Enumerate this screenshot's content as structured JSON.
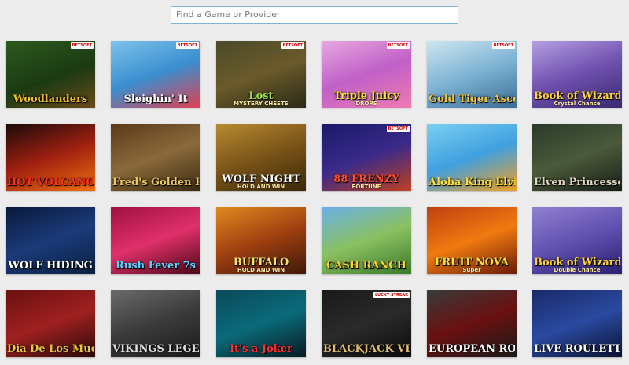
{
  "search": {
    "placeholder": "Find a Game or Provider",
    "value": ""
  },
  "games": [
    {
      "title": "Woodlanders",
      "subtitle": "",
      "badge": "BETSOFT",
      "bg": "linear-gradient(160deg,#2d5a1e,#1b3a12 55%,#6a4a1a)",
      "title_color": "#f0c030"
    },
    {
      "title": "Sleighin' It",
      "subtitle": "",
      "badge": "BETSOFT",
      "bg": "linear-gradient(160deg,#7ec3ea,#3a8fd0 50%,#e04050)",
      "title_color": "#ffffff"
    },
    {
      "title": "Lost",
      "subtitle": "MYSTERY CHESTS",
      "badge": "BETSOFT",
      "bg": "linear-gradient(160deg,#4a4a2a,#6b5a2a 50%,#2a2a18)",
      "title_color": "#9fe04a"
    },
    {
      "title": "Triple Juicy",
      "subtitle": "DROPS",
      "badge": "BETSOFT",
      "bg": "linear-gradient(160deg,#e8a8e0,#c060c8 50%,#f07ab0)",
      "title_color": "#ffe040"
    },
    {
      "title": "Gold Tiger Ascent",
      "subtitle": "",
      "badge": "BETSOFT",
      "bg": "linear-gradient(160deg,#cfe6f2,#7db3d3 50%,#3c6e95)",
      "title_color": "#f5c542"
    },
    {
      "title": "Book of Wizard",
      "subtitle": "Crystal Chance",
      "badge": "",
      "bg": "linear-gradient(160deg,#b4a0e0,#7050b0 50%,#3a2a70)",
      "title_color": "#ffd040"
    },
    {
      "title": "HOT VOLCANO",
      "subtitle": "",
      "badge": "",
      "bg": "linear-gradient(160deg,#1a0a0a,#a02010 50%,#f07010)",
      "title_color": "#ff3020"
    },
    {
      "title": "Fred's Golden Path",
      "subtitle": "",
      "badge": "",
      "bg": "linear-gradient(160deg,#5a3a1a,#8a6a3a 50%,#3a2a10)",
      "title_color": "#f0c860"
    },
    {
      "title": "WOLF NIGHT",
      "subtitle": "HOLD AND WIN",
      "badge": "",
      "bg": "linear-gradient(160deg,#b88a30,#7a5418 50%,#3a2808)",
      "title_color": "#ffffff"
    },
    {
      "title": "88 FRENZY",
      "subtitle": "FORTUNE",
      "badge": "BETSOFT",
      "bg": "linear-gradient(160deg,#1a1a6a,#3a2a8a 50%,#c04020)",
      "title_color": "#ff5030"
    },
    {
      "title": "Aloha King Elvis!",
      "subtitle": "",
      "badge": "",
      "bg": "linear-gradient(160deg,#7ad0f0,#40a0e0 50%,#f0a020)",
      "title_color": "#ffe040"
    },
    {
      "title": "Elven Princesses",
      "subtitle": "",
      "badge": "",
      "bg": "linear-gradient(160deg,#2a3a2a,#4a5a3a 50%,#1a2018)",
      "title_color": "#e0d8c0"
    },
    {
      "title": "WOLF HIDING",
      "subtitle": "",
      "badge": "",
      "bg": "linear-gradient(160deg,#0a1a3a,#1a3a7a 50%,#0a2040)",
      "title_color": "#ffffff"
    },
    {
      "title": "Rush Fever 7s",
      "subtitle": "",
      "badge": "",
      "bg": "linear-gradient(160deg,#a01040,#e0306a 50%,#4a0818)",
      "title_color": "#60d0ff"
    },
    {
      "title": "BUFFALO",
      "subtitle": "HOLD AND WIN",
      "badge": "",
      "bg": "linear-gradient(160deg,#e08a20,#a04010 50%,#401808)",
      "title_color": "#ffe070"
    },
    {
      "title": "CASH RANCH",
      "subtitle": "",
      "badge": "",
      "bg": "linear-gradient(160deg,#6ab0e8,#8ac060 50%,#3a7a2a)",
      "title_color": "#ffd030"
    },
    {
      "title": "FRUIT NOVA",
      "subtitle": "Super",
      "badge": "",
      "bg": "linear-gradient(160deg,#c04010,#f07a10 50%,#6a1a08)",
      "title_color": "#ffe040"
    },
    {
      "title": "Book of Wizard",
      "subtitle": "Double Chance",
      "badge": "",
      "bg": "linear-gradient(160deg,#9080d0,#6050b0 50%,#2a2070)",
      "title_color": "#ffd040"
    },
    {
      "title": "Dia De Los Muertos",
      "subtitle": "",
      "badge": "",
      "bg": "linear-gradient(160deg,#6a1010,#a02020 50%,#2a0808)",
      "title_color": "#f0c040"
    },
    {
      "title": "VIKINGS LEGEND",
      "subtitle": "",
      "badge": "",
      "bg": "linear-gradient(160deg,#6a6a6a,#3a3a3a 50%,#1a1a1a)",
      "title_color": "#e0e0e0"
    },
    {
      "title": "It's a Joker",
      "subtitle": "",
      "badge": "",
      "bg": "linear-gradient(160deg,#0a4a5a,#0a6a7a 50%,#081a20)",
      "title_color": "#ff3030"
    },
    {
      "title": "BLACKJACK VIP",
      "subtitle": "",
      "badge": "LUCKY STREAK",
      "bg": "linear-gradient(160deg,#1a1a1a,#2a2a2a 50%,#0a0a0a)",
      "title_color": "#e0c070"
    },
    {
      "title": "EUROPEAN ROULETTE",
      "subtitle": "",
      "badge": "",
      "bg": "linear-gradient(160deg,#3a3a3a,#6a1010 50%,#1a1a1a)",
      "title_color": "#ffffff"
    },
    {
      "title": "LIVE ROULETTE",
      "subtitle": "",
      "badge": "",
      "bg": "linear-gradient(160deg,#1a2a6a,#2a4aa0 50%,#0a1030)",
      "title_color": "#ffffff"
    }
  ]
}
